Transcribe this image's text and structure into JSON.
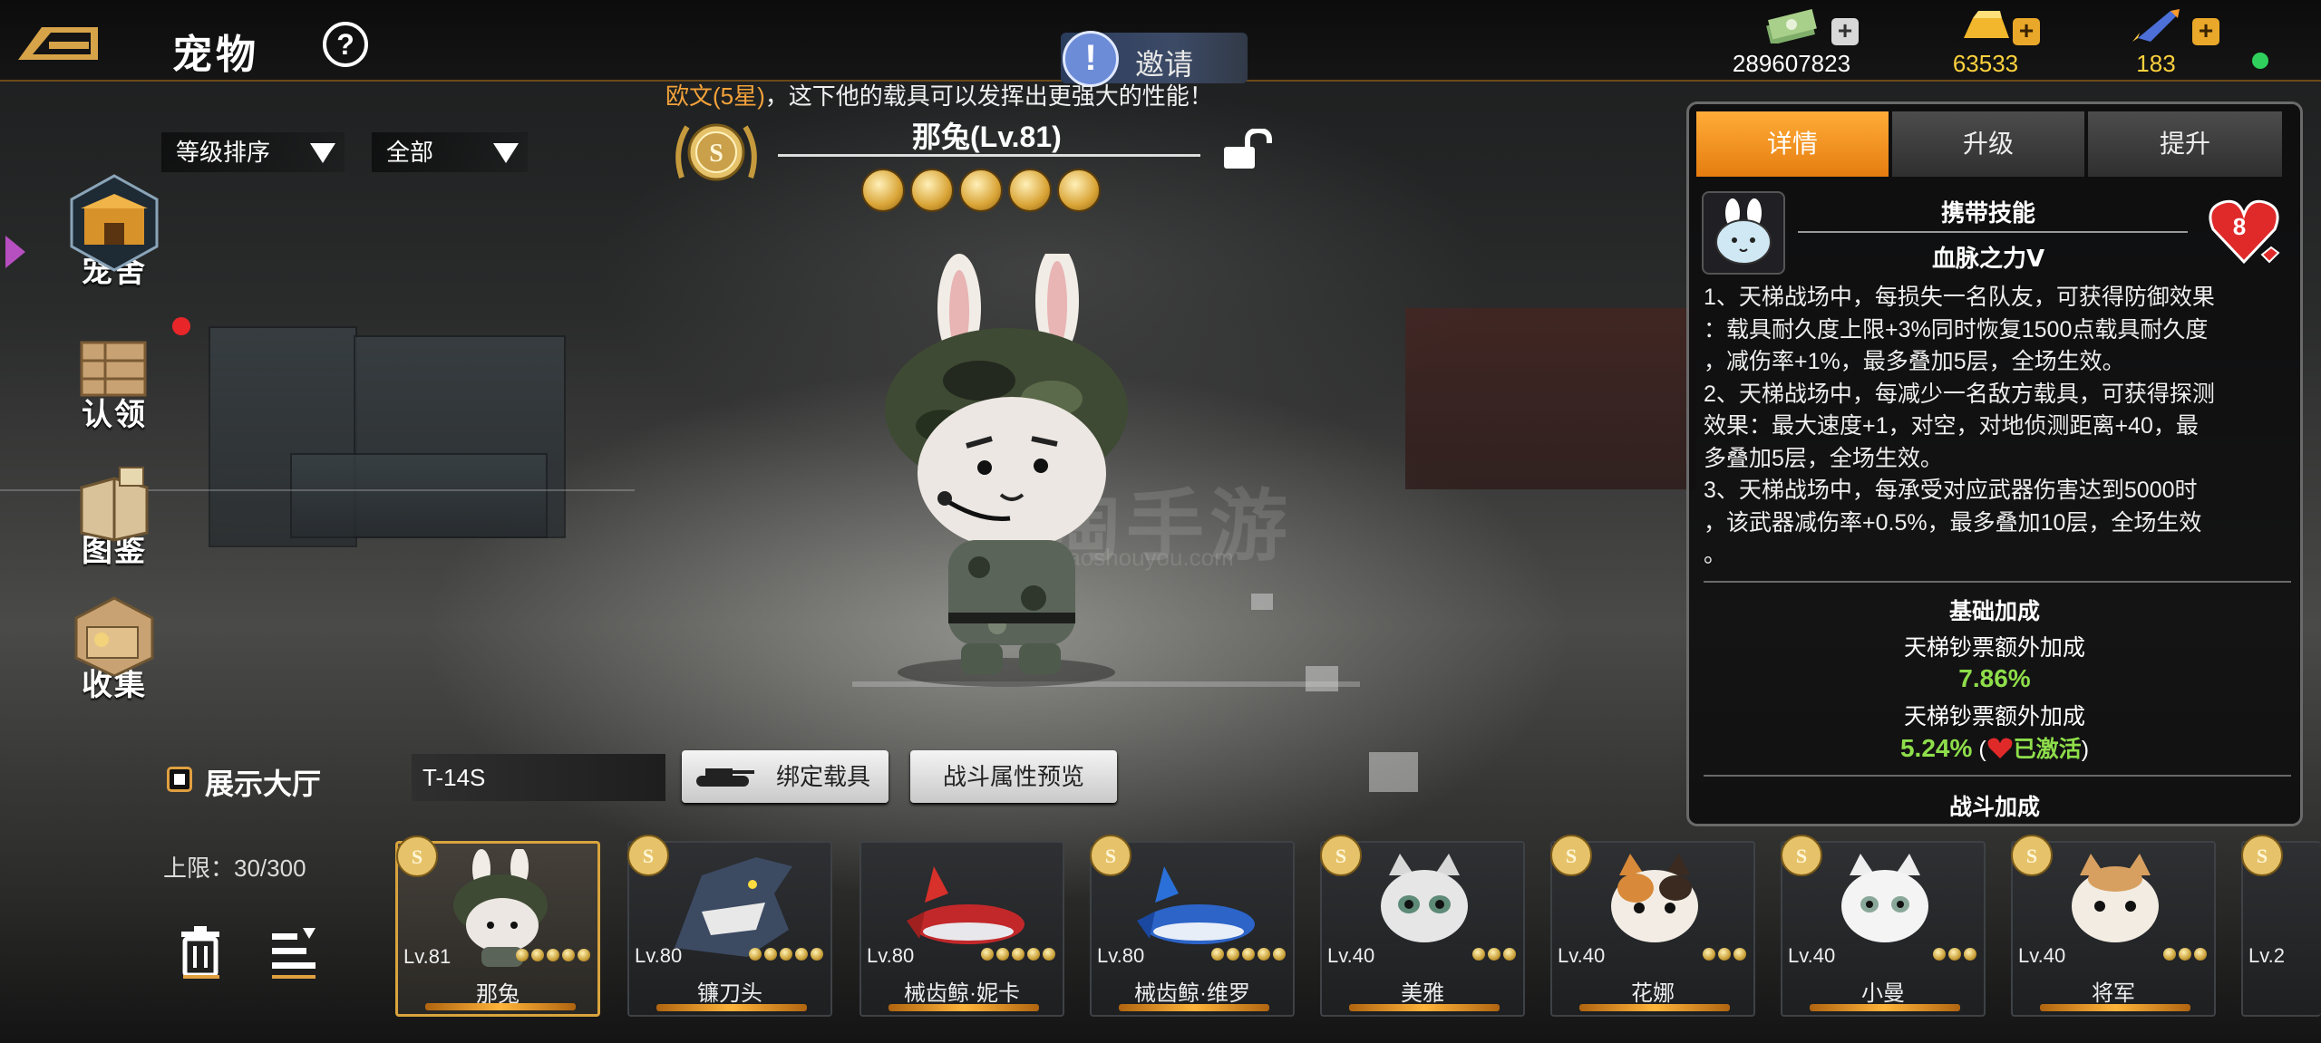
{
  "topbar": {
    "title": "宠物",
    "help_symbol": "?",
    "invite_label": "邀请",
    "currencies": [
      {
        "icon": "cash-icon",
        "value": "289607823"
      },
      {
        "icon": "gold-bar-icon",
        "value": "63533"
      },
      {
        "icon": "rocket-icon",
        "value": "183"
      }
    ]
  },
  "subtitle": {
    "highlight": "欧文(5星)",
    "text": "，这下他的载具可以发挥出更强大的性能！"
  },
  "filters": {
    "sort_label": "等级排序",
    "type_label": "全部"
  },
  "nav": [
    {
      "label": "宠舍",
      "icon": "kennel-icon"
    },
    {
      "label": "认领",
      "icon": "adopt-crate-icon"
    },
    {
      "label": "图鉴",
      "icon": "handbook-icon"
    },
    {
      "label": "收集",
      "icon": "collection-box-icon"
    }
  ],
  "pet": {
    "name": "那兔",
    "level": "(Lv.81)",
    "bells": 5
  },
  "controls": {
    "show_hall_label": "展示大厅",
    "limit_text": "上限：30/300",
    "vehicle_name": "T-14S",
    "bind_vehicle_label": "绑定载具",
    "battle_preview_label": "战斗属性预览"
  },
  "panel": {
    "tabs": [
      "详情",
      "升级",
      "提升"
    ],
    "active_tab": 0,
    "skill_header": "携带技能",
    "skill_name": "血脉之力Ⅴ",
    "heart_value": "8",
    "skill_desc": [
      "1、天梯战场中，每损失一名队友，可获得防御效果",
      "：载具耐久度上限+3%同时恢复1500点载具耐久度",
      "，减伤率+1%，最多叠加5层，全场生效。",
      "2、天梯战场中，每减少一名敌方载具，可获得探测",
      "效果：最大速度+1，对空，对地侦测距离+40，最",
      "多叠加5层，全场生效。",
      "3、天梯战场中，每承受对应武器伤害达到5000时",
      "，该武器减伤率+0.5%，最多叠加10层，全场生效",
      "。"
    ],
    "base_bonus_title": "基础加成",
    "bonus1_label": "天梯钞票额外加成",
    "bonus1_value": "7.86%",
    "bonus2_label": "天梯钞票额外加成",
    "bonus2_value": "5.24%",
    "bonus2_paren_open": "(",
    "bonus2_status": "已激活",
    "bonus2_paren_close": ")",
    "battle_bonus_title": "战斗加成"
  },
  "roster": [
    {
      "level": "Lv.81",
      "name": "那兔",
      "stars": 5,
      "selected": true,
      "kind": "rabbit"
    },
    {
      "level": "Lv.80",
      "name": "镰刀头",
      "stars": 5,
      "selected": false,
      "kind": "shark"
    },
    {
      "level": "Lv.80",
      "name": "械齿鲸·妮卡",
      "stars": 5,
      "selected": false,
      "kind": "red-whale"
    },
    {
      "level": "Lv.80",
      "name": "械齿鲸·维罗",
      "stars": 5,
      "selected": false,
      "kind": "blue-whale"
    },
    {
      "level": "Lv.40",
      "name": "美雅",
      "stars": 3,
      "selected": false,
      "kind": "grey-cat"
    },
    {
      "level": "Lv.40",
      "name": "花娜",
      "stars": 3,
      "selected": false,
      "kind": "calico-cat"
    },
    {
      "level": "Lv.40",
      "name": "小曼",
      "stars": 3,
      "selected": false,
      "kind": "white-cat"
    },
    {
      "level": "Lv.40",
      "name": "将军",
      "stars": 3,
      "selected": false,
      "kind": "orange-cat"
    },
    {
      "level": "Lv.2",
      "name": "",
      "stars": 0,
      "selected": false,
      "kind": "partial"
    }
  ],
  "watermark": {
    "main": "淘手游",
    "sub": "taoshouyou.com"
  },
  "colors": {
    "accent": "#f0932b",
    "gold": "#d9a43e",
    "green": "#8ede4a",
    "online": "#2fd15c"
  }
}
